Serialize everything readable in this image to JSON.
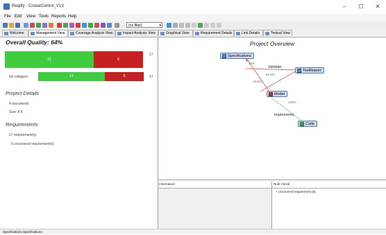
{
  "window": {
    "title": "Reqtify - CruiseControl_V13",
    "minimize": "–",
    "maximize": "☐",
    "close": "✕"
  },
  "menu": [
    "File",
    "Edit",
    "View",
    "Tools",
    "Reports",
    "Help"
  ],
  "toolbar": {
    "filter_value": "(no filter)",
    "filter_arrow": "▾"
  },
  "tabs": [
    {
      "label": "Welcome",
      "active": false
    },
    {
      "label": "Management View",
      "active": true
    },
    {
      "label": "Coverage Analysis View",
      "active": false
    },
    {
      "label": "Impact Analysis View",
      "active": false
    },
    {
      "label": "Graphical View",
      "active": false
    },
    {
      "label": "Requirement Details",
      "active": false
    },
    {
      "label": "Link Details",
      "active": false
    },
    {
      "label": "Textual View",
      "active": false
    }
  ],
  "management": {
    "overall_title": "Overall Quality: 64%",
    "overall": {
      "covered": "11",
      "uncovered": "6",
      "total": "17"
    },
    "category_label": "No category",
    "category": {
      "covered": "11",
      "uncovered": "6",
      "total": "17"
    },
    "project_details_heading": "Project Details",
    "documents": "4 documents",
    "size": "Size: 8 K",
    "requirements_heading": "Requirements",
    "requirements_count": "17 requirement(s)",
    "uncovered_count": "6 uncovered requirement(s)"
  },
  "project_overview": {
    "title": "Project Overview",
    "nodes": {
      "specifications": "Specifications",
      "testreport": "TestReport",
      "model": "Model",
      "code": "Code"
    },
    "relations": {
      "validate": "Validate",
      "implements": "Implements"
    },
    "percentages": {
      "spec_top": "40%",
      "validate_pct": "61.6%",
      "spec_model": "16.6%",
      "model_code": "100%"
    }
  },
  "information": {
    "label": "Information:"
  },
  "rule_check": {
    "label": "Rule Check:",
    "item": "Uncovered requirement (6)",
    "expander": "+"
  },
  "status": {
    "text": "Specifications    Specifications"
  },
  "colors": {
    "covered": "#3fcd3f",
    "uncovered": "#c62020",
    "validate_line": "#e06b6b",
    "implements_line": "#6bc26b"
  }
}
